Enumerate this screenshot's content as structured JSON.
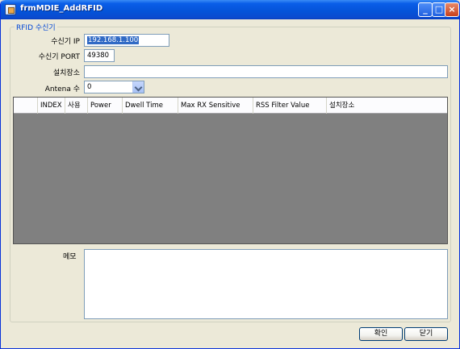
{
  "window": {
    "title": "frmMDIE_AddRFID",
    "controls": [
      "minimize-icon",
      "maximize-icon",
      "close-icon"
    ]
  },
  "group": {
    "label": "RFID 수신기"
  },
  "form": {
    "ip_label": "수신기 IP",
    "ip_value": "192.168.1.100",
    "port_label": "수신기 PORT",
    "port_value": "49380",
    "location_label": "설치장소",
    "location_value": "",
    "antenna_label": "Antena 수",
    "antenna_value": "0"
  },
  "grid": {
    "columns": [
      "INDEX",
      "사용",
      "Power",
      "Dwell Time",
      "Max RX Sensitive",
      "RSS Filter Value",
      "설치장소"
    ],
    "rows": []
  },
  "memo": {
    "label": "메모",
    "value": ""
  },
  "buttons": {
    "confirm": "확인",
    "close": "닫기"
  },
  "colors": {
    "titlebar": "#0453d8",
    "group_label": "#0046d5",
    "grid_background": "#808080",
    "selection": "#316ac5"
  }
}
